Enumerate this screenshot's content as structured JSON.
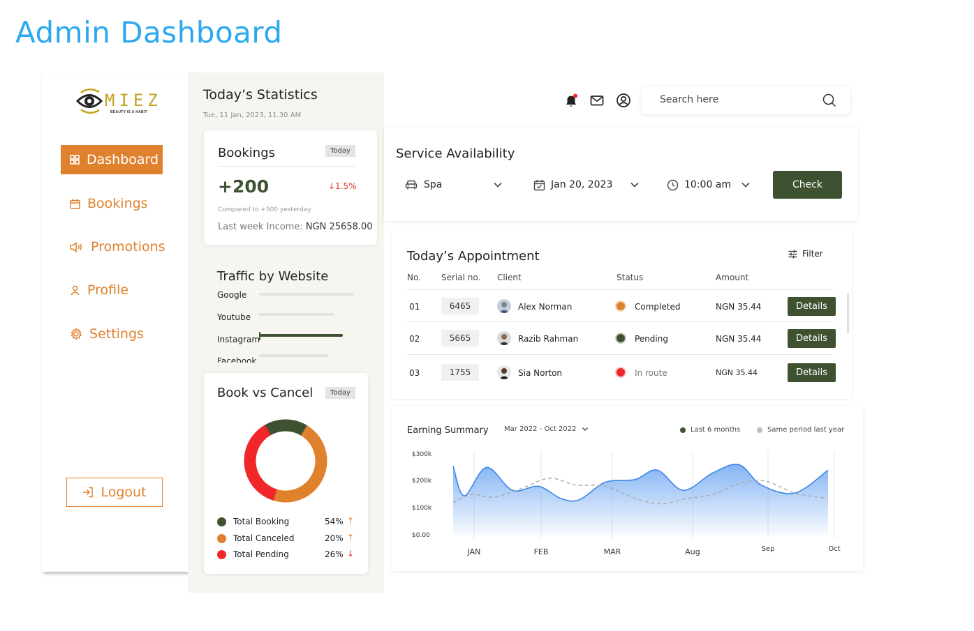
{
  "page_heading": "Admin Dashboard",
  "brand": {
    "name": "MIEZ",
    "tagline": "BEAUTY IS A HABIT"
  },
  "sidebar": {
    "items": [
      {
        "label": "Dashboard",
        "icon": "grid-icon",
        "active": true
      },
      {
        "label": "Bookings",
        "icon": "calendar-icon"
      },
      {
        "label": "Promotions",
        "icon": "megaphone-icon"
      },
      {
        "label": "Profile",
        "icon": "user-icon"
      },
      {
        "label": "Settings",
        "icon": "gear-icon"
      }
    ],
    "logout_label": "Logout"
  },
  "stats": {
    "title": "Today’s Statistics",
    "date": "Tue, 11 Jan, 2023, 11.30 AM",
    "bookings": {
      "title": "Bookings",
      "tag": "Today",
      "value": "+200",
      "change": "↓1.5%",
      "compare": "Compared to +500 yesterday",
      "income_label": "Last week Income:",
      "income_value": "NGN 25658.00"
    },
    "traffic": {
      "title": "Traffic by Website",
      "sites": [
        {
          "name": "Google",
          "share": 0.72
        },
        {
          "name": "Youtube",
          "share": 0.57
        },
        {
          "name": "Instagram",
          "share": 0.62,
          "highlight": true
        },
        {
          "name": "Facebook",
          "share": 0.52
        }
      ]
    },
    "book_vs_cancel": {
      "title": "Book vs Cancel",
      "tag": "Today",
      "segments": [
        {
          "name": "Total Booking",
          "pct": "54%",
          "trend": "↑",
          "color": "#3E5232",
          "value": 54
        },
        {
          "name": "Total Canceled",
          "pct": "20%",
          "trend": "↑",
          "color": "#E0812E",
          "value": 20
        },
        {
          "name": "Total Pending",
          "pct": "26%",
          "trend": "↓",
          "color": "#F1262A",
          "value": 26
        }
      ]
    }
  },
  "topbar": {
    "icons": [
      "bell-icon",
      "mail-icon",
      "account-icon"
    ],
    "search_placeholder": "Search here"
  },
  "service": {
    "title": "Service Availability",
    "service_value": "Spa",
    "date_value": "Jan 20, 2023",
    "time_value": "10:00 am",
    "check_label": "Check"
  },
  "appointments": {
    "title": "Today’s Appointment",
    "filter_label": "Filter",
    "columns": [
      "No.",
      "Serial no.",
      "Client",
      "Status",
      "Amount"
    ],
    "rows": [
      {
        "no": "01",
        "serial": "6465",
        "client": "Alex Norman",
        "status": "Completed",
        "status_color": "#E0812E",
        "amount": "NGN 35.44",
        "action": "Details"
      },
      {
        "no": "02",
        "serial": "5665",
        "client": "Razib Rahman",
        "status": "Pending",
        "status_color": "#3E5232",
        "amount": "NGN 35.44",
        "action": "Details"
      },
      {
        "no": "03",
        "serial": "1755",
        "client": "Sia Norton",
        "status": "In route",
        "status_color": "#F1262A",
        "amount": "NGN 35.44",
        "action": "Details"
      }
    ]
  },
  "earnings": {
    "title": "Earning Summary",
    "range": "Mar 2022 - Oct 2022",
    "legend": [
      {
        "name": "Last 6 months",
        "color": "#3E5232"
      },
      {
        "name": "Same period last year",
        "color": "#BDBDBD"
      }
    ]
  },
  "chart_data": {
    "type": "area",
    "title": "Earning Summary",
    "y_ticks": [
      "$300k",
      "$200k",
      "$100k",
      "$0.00"
    ],
    "ylim": [
      0,
      300000
    ],
    "x_labels": [
      "JAN",
      "FEB",
      "MAR",
      "Aug",
      "Sep",
      "Oct"
    ],
    "series": [
      {
        "name": "Last 6 months",
        "style": "area",
        "x": [
          0,
          0.15,
          0.45,
          0.8,
          1.15,
          1.45,
          1.7,
          2.05,
          2.45,
          2.75,
          3.1,
          3.5,
          3.85,
          4.15,
          4.6,
          5.05
        ],
        "values": [
          260000,
          150000,
          255000,
          170000,
          185000,
          140000,
          135000,
          200000,
          210000,
          245000,
          170000,
          235000,
          265000,
          190000,
          160000,
          245000
        ]
      },
      {
        "name": "Same period last year",
        "style": "dashed",
        "x": [
          0,
          0.25,
          0.55,
          0.95,
          1.3,
          1.65,
          2.05,
          2.45,
          2.8,
          3.15,
          3.5,
          3.85,
          4.2,
          4.6,
          5.05
        ],
        "values": [
          125000,
          155000,
          145000,
          180000,
          215000,
          190000,
          185000,
          140000,
          120000,
          140000,
          155000,
          195000,
          205000,
          160000,
          140000
        ]
      }
    ]
  }
}
